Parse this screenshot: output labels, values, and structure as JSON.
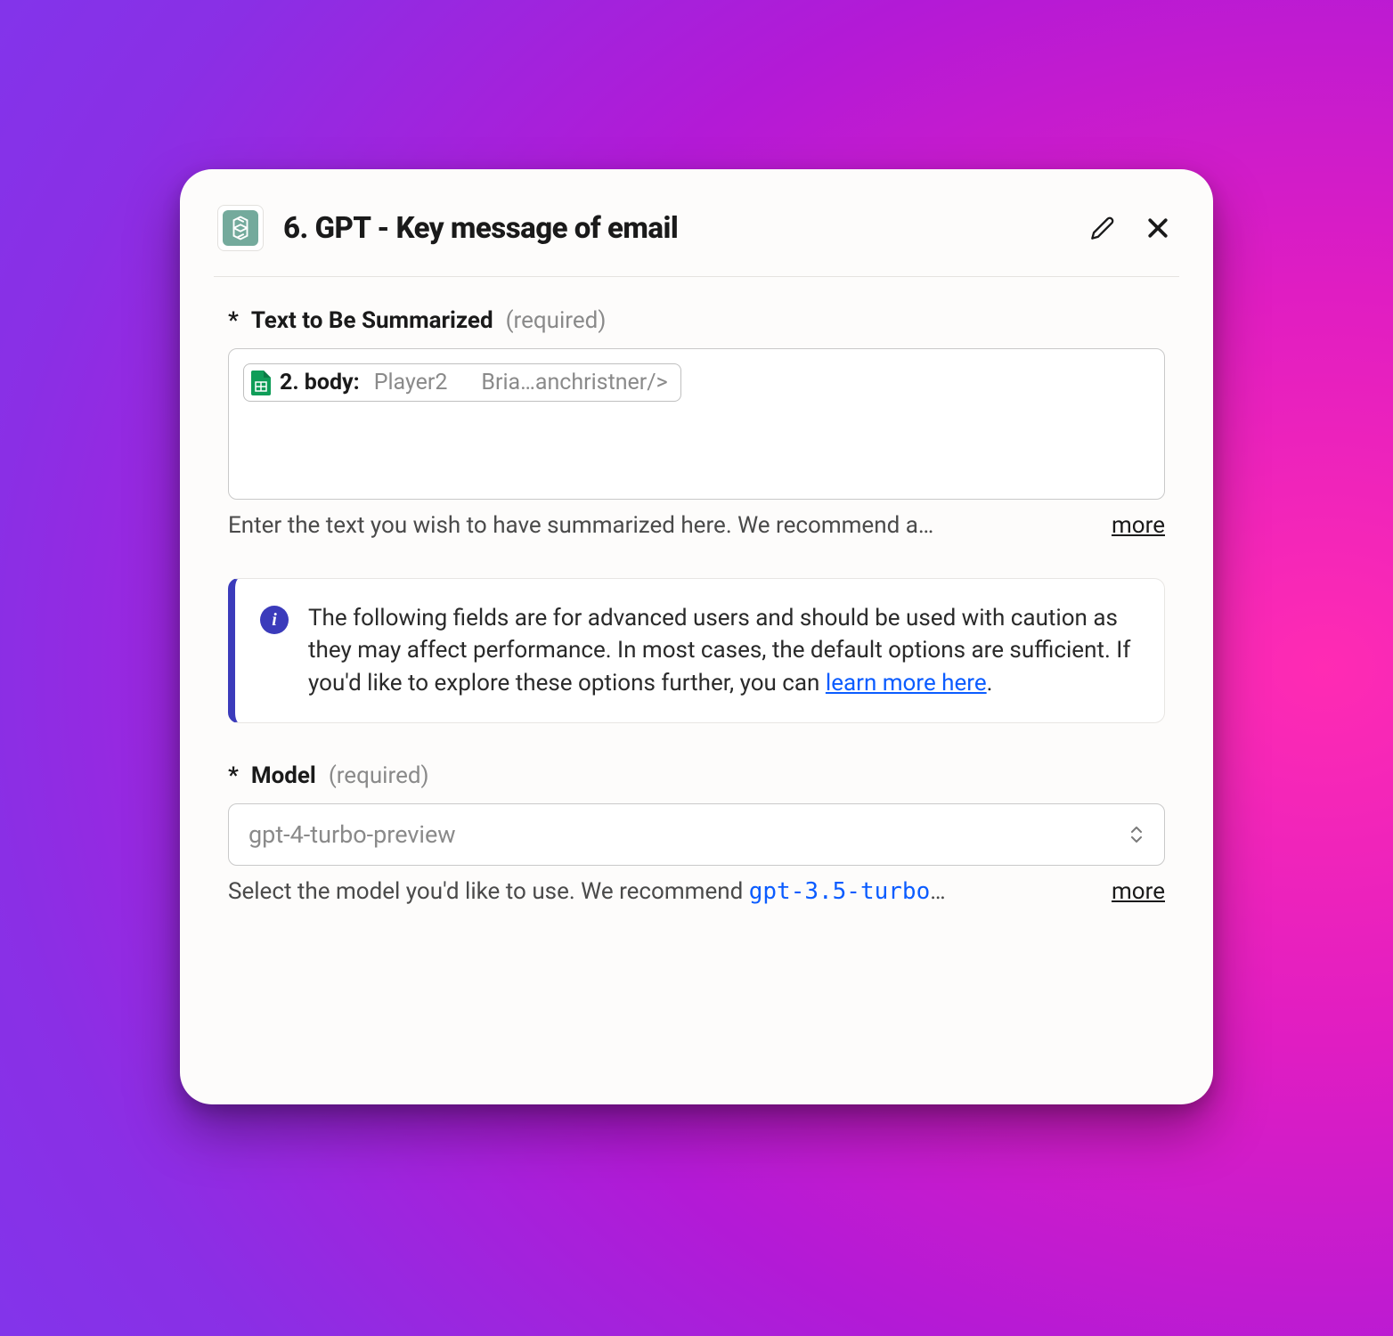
{
  "header": {
    "title": "6. GPT - Key message of email"
  },
  "textField": {
    "label": "Text to Be Summarized",
    "required": "(required)",
    "pill": {
      "prefix": "2. body:",
      "value1": "Player2",
      "value2": "Bria…anchristner/>"
    },
    "helper": "Enter the text you wish to have summarized here. We recommend a…",
    "more": "more"
  },
  "info": {
    "text": "The following fields are for advanced users and should be used with caution as they may affect performance. In most cases, the default options are sufficient. If you'd like to explore these options further, you can ",
    "linkText": "learn more here",
    "suffix": "."
  },
  "modelField": {
    "label": "Model",
    "required": "(required)",
    "value": "gpt-4-turbo-preview",
    "helperPrefix": "Select the model you'd like to use. We recommend ",
    "helperCode": "gpt-3.5-turbo",
    "helperSuffix": "…",
    "more": "more"
  }
}
